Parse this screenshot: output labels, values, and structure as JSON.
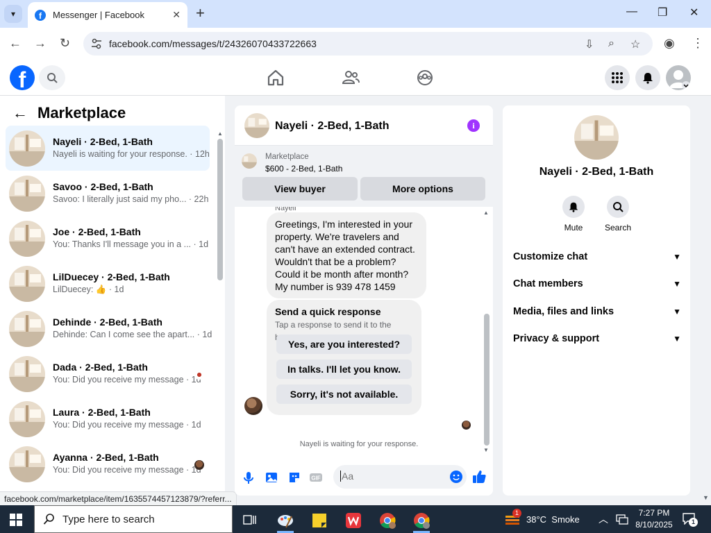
{
  "browser": {
    "tab_title": "Messenger | Facebook",
    "url": "facebook.com/messages/t/24326070433722663",
    "status_url": "facebook.com/marketplace/item/1635574457123879/?referr..."
  },
  "left_panel": {
    "title": "Marketplace",
    "conversations": [
      {
        "name": "Nayeli · 2-Bed, 1-Bath",
        "preview": "Nayeli is waiting for your response. · 12h",
        "active": true
      },
      {
        "name": "Savoo · 2-Bed, 1-Bath",
        "preview": "Savoo: I literally just said my pho... · 22h"
      },
      {
        "name": "Joe · 2-Bed, 1-Bath",
        "preview": "You: Thanks I'll message you in a ... · 1d"
      },
      {
        "name": "LilDuecey · 2-Bed, 1-Bath",
        "preview": "LilDuecey: 👍 · 1d"
      },
      {
        "name": "Dehinde · 2-Bed, 1-Bath",
        "preview": "Dehinde: Can I come see the apart... · 1d"
      },
      {
        "name": "Dada · 2-Bed, 1-Bath",
        "preview": "You: Did you receive my message · 1d"
      },
      {
        "name": "Laura · 2-Bed, 1-Bath",
        "preview": "You: Did you receive my message · 1d"
      },
      {
        "name": "Ayanna · 2-Bed, 1-Bath",
        "preview": "You: Did you receive my message · 1d"
      }
    ]
  },
  "chat": {
    "header_name": "Nayeli · 2-Bed, 1-Bath",
    "listing_label": "Marketplace",
    "listing_price": "$600 - 2-Bed, 1-Bath",
    "view_buyer": "View buyer",
    "more_options": "More options",
    "sender_label": "Nayeli",
    "message": "Greetings, I'm interested in your property. We're travelers and can't have an extended contract. Wouldn't that be a problem? Could it be month after month? My number is 939 478 1459",
    "quick_title": "Send a quick response",
    "quick_subtitle": "Tap a response to send it to the buyer.",
    "quick_replies": [
      "Yes, are you interested?",
      "In talks. I'll let you know.",
      "Sorry, it's not available."
    ],
    "waiting_text": "Nayeli is waiting for your response.",
    "input_placeholder": "Aa"
  },
  "right_panel": {
    "name": "Nayeli · 2-Bed, 1-Bath",
    "mute": "Mute",
    "search": "Search",
    "sections": [
      "Customize chat",
      "Chat members",
      "Media, files and links",
      "Privacy & support"
    ]
  },
  "taskbar": {
    "search_placeholder": "Type here to search",
    "weather": "38°C  Smoke",
    "time": "7:27 PM",
    "date": "8/10/2025",
    "notification_count": "1",
    "weather_badge": "1"
  },
  "colors": {
    "facebook_blue": "#0866ff",
    "active_conv": "#ebf5ff",
    "info_purple": "#a033ff",
    "taskbar": "#1c2a3a"
  }
}
